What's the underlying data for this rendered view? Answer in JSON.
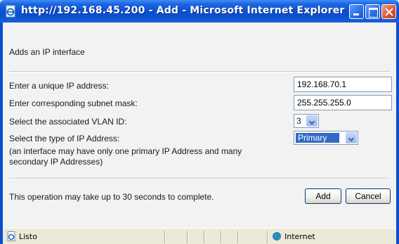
{
  "window": {
    "title": "http://192.168.45.200 - Add - Microsoft Internet Explorer",
    "icon": "ie-page-icon"
  },
  "form": {
    "heading": "Adds an IP interface",
    "fields": [
      {
        "label": "Enter a unique IP address:",
        "value": "192.168.70.1"
      },
      {
        "label": "Enter corresponding subnet mask:",
        "value": "255.255.255.0"
      },
      {
        "label": "Select the associated VLAN ID:",
        "value": "3"
      },
      {
        "label": "Select the type of IP Address:",
        "value": "Primary"
      }
    ],
    "note": "(an interface may have only one primary IP Address and many secondary IP Addresses)",
    "footer_text": "This operation may take up to 30 seconds to complete.",
    "add_label": "Add",
    "cancel_label": "Cancel"
  },
  "statusbar": {
    "status": "Listo",
    "zone": "Internet"
  },
  "colors": {
    "titlebar": "#0a4fcf",
    "selection": "#316ac5",
    "content_bg": "#f2f2f2"
  }
}
